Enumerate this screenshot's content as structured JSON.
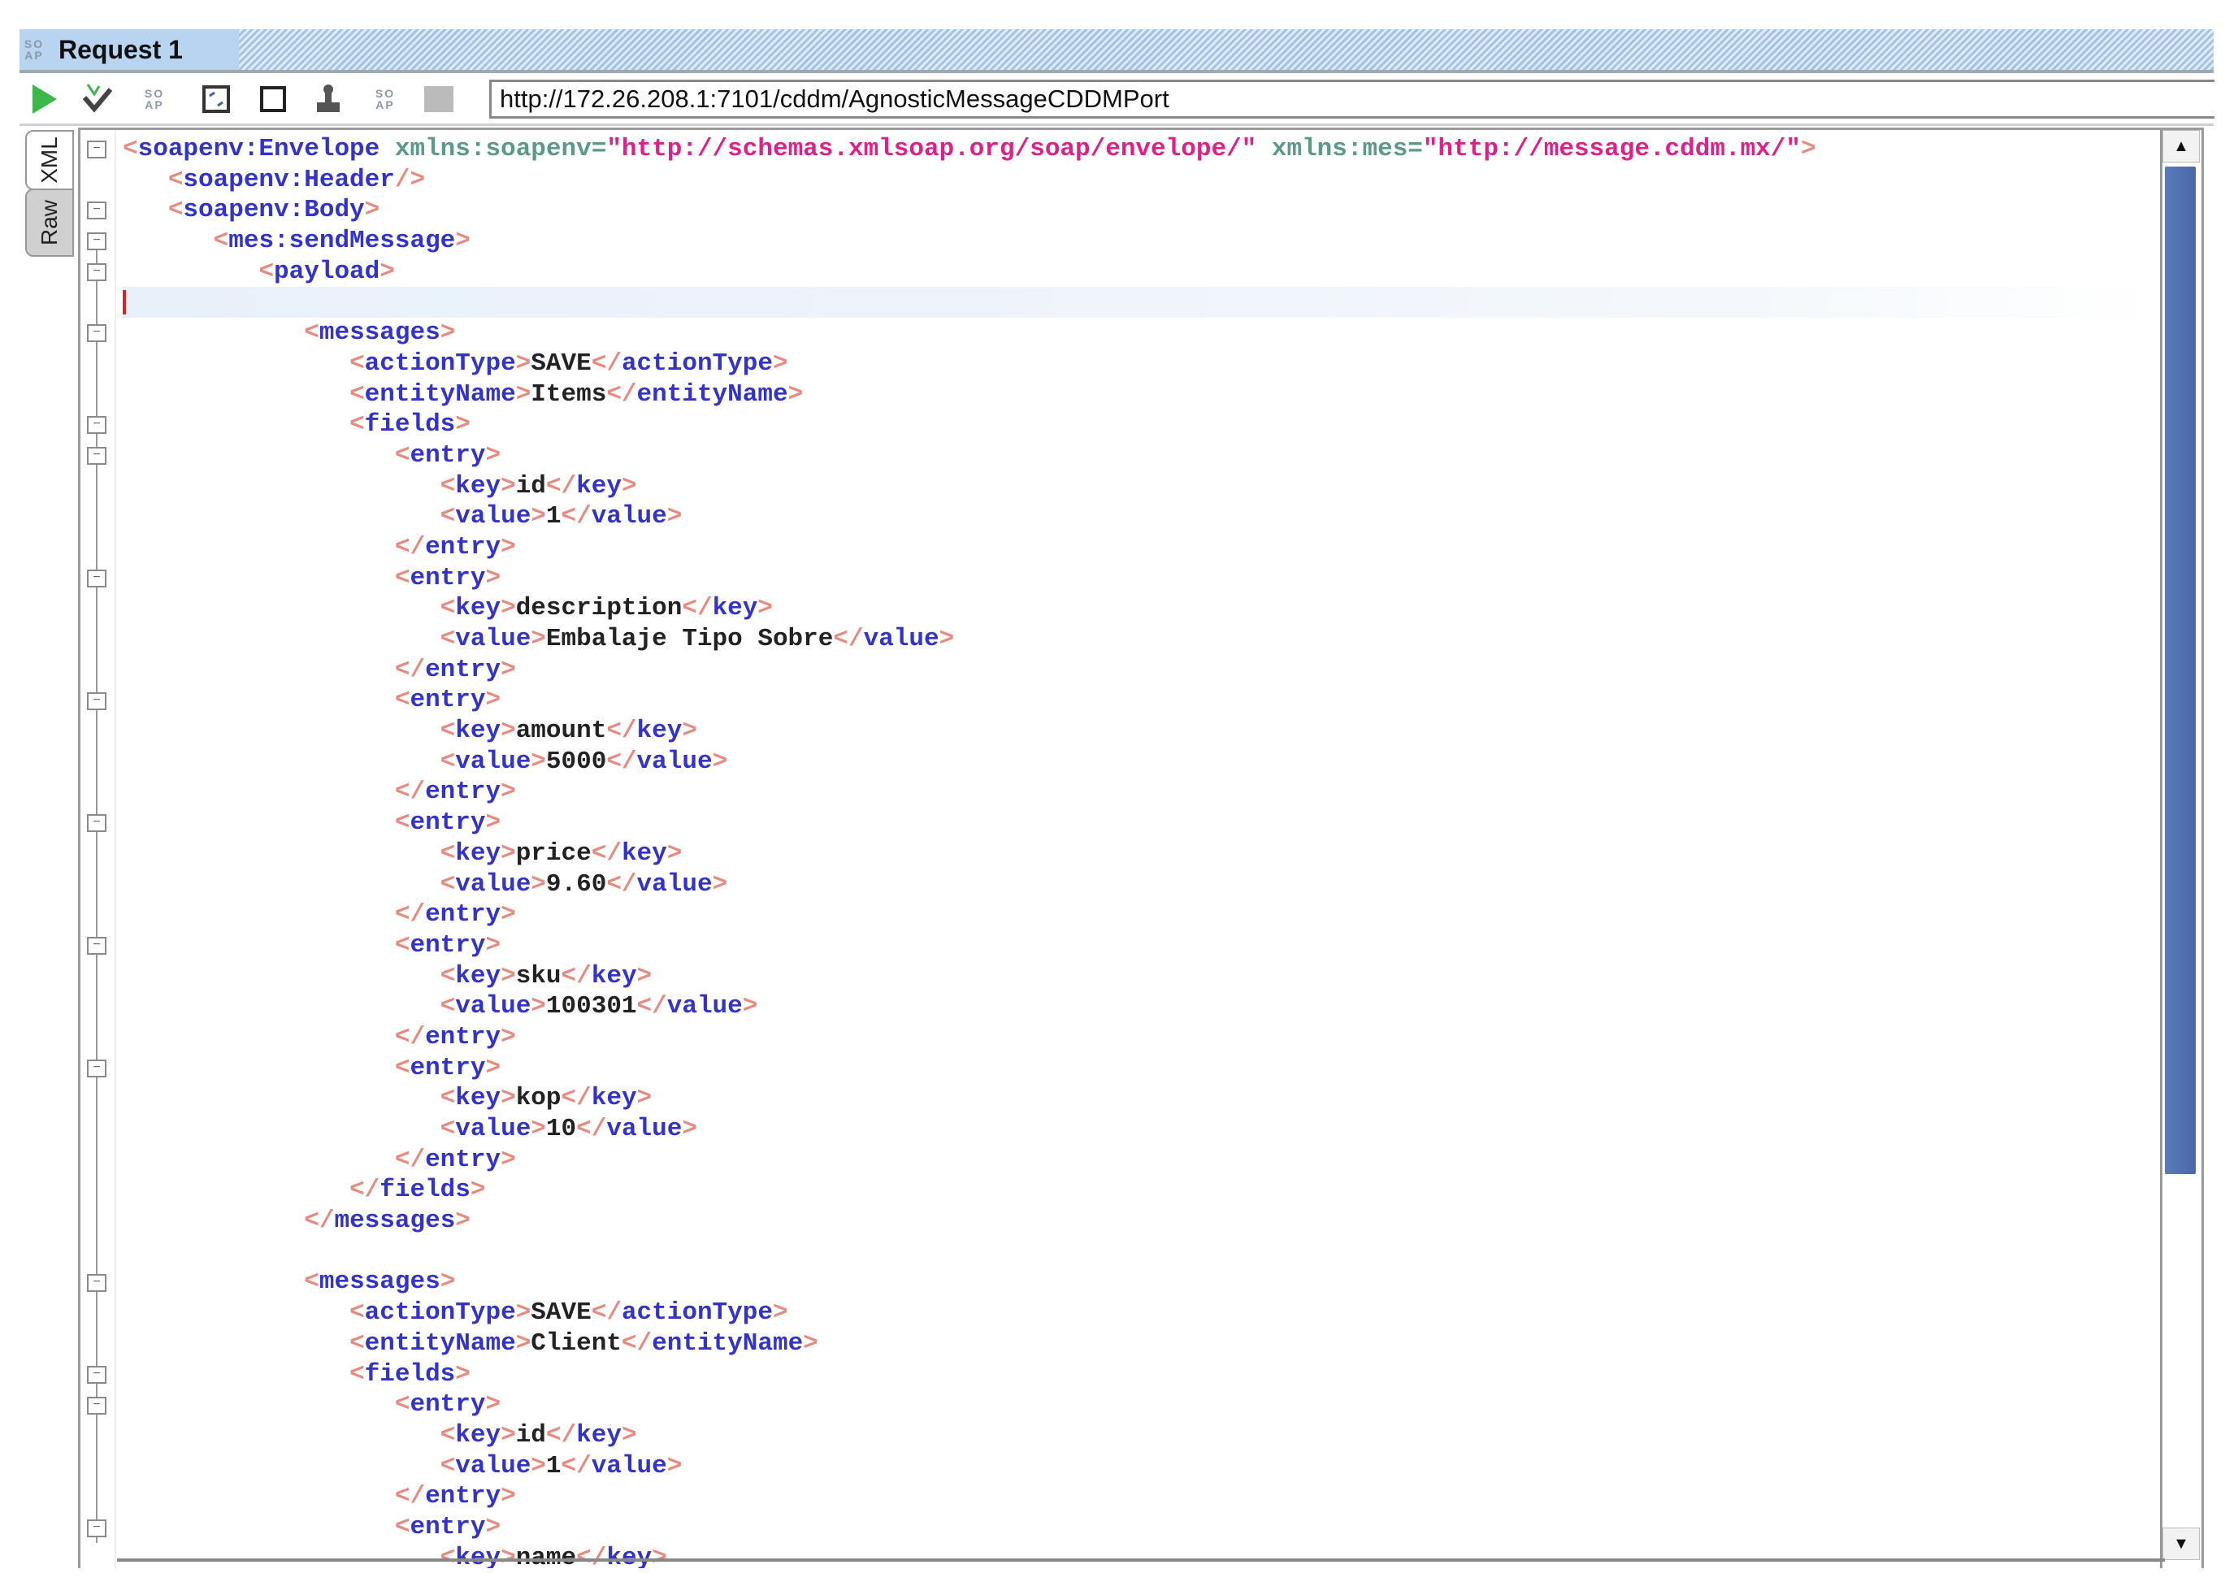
{
  "window": {
    "title": "Request 1",
    "soap_badge": "SOAP"
  },
  "toolbar": {
    "url": "http://172.26.208.1:7101/cddm/AgnosticMessageCDDMPort",
    "icons": [
      "run-icon",
      "validate-icon",
      "soap-icon",
      "frame-icon",
      "square-icon",
      "stamp-icon",
      "soap-icon",
      "stop-icon"
    ]
  },
  "side_tabs": {
    "xml": "XML",
    "raw": "Raw",
    "active": "XML"
  },
  "colors": {
    "bracket": "#e88a80",
    "tag": "#3333cc",
    "text": "#222222",
    "attr_name": "#5a9a8a",
    "attr_value": "#e0208a",
    "cursor": "#e02020",
    "scroll_thumb": "#5a7ab8"
  },
  "editor": {
    "current_line": 5,
    "scroll_position": 0.0,
    "lines": [
      {
        "indent": 0,
        "fold": true,
        "text": "<soapenv:Envelope xmlns:soapenv=\"http://schemas.xmlsoap.org/soap/envelope/\" xmlns:mes=\"http://message.cddm.mx/\">"
      },
      {
        "indent": 1,
        "text": "<soapenv:Header/>"
      },
      {
        "indent": 1,
        "fold": true,
        "text": "<soapenv:Body>"
      },
      {
        "indent": 2,
        "fold": true,
        "text": "<mes:sendMessage>"
      },
      {
        "indent": 3,
        "fold": true,
        "text": "<payload>"
      },
      {
        "indent": 0,
        "text": ""
      },
      {
        "indent": 4,
        "fold": true,
        "text": "<messages>"
      },
      {
        "indent": 5,
        "text": "<actionType>SAVE</actionType>"
      },
      {
        "indent": 5,
        "text": "<entityName>Items</entityName>"
      },
      {
        "indent": 5,
        "fold": true,
        "text": "<fields>"
      },
      {
        "indent": 6,
        "fold": true,
        "text": "<entry>"
      },
      {
        "indent": 7,
        "text": "<key>id</key>"
      },
      {
        "indent": 7,
        "text": "<value>1</value>"
      },
      {
        "indent": 6,
        "text": "</entry>"
      },
      {
        "indent": 6,
        "fold": true,
        "text": "<entry>"
      },
      {
        "indent": 7,
        "text": "<key>description</key>"
      },
      {
        "indent": 7,
        "text": "<value>Embalaje Tipo Sobre</value>"
      },
      {
        "indent": 6,
        "text": "</entry>"
      },
      {
        "indent": 6,
        "fold": true,
        "text": "<entry>"
      },
      {
        "indent": 7,
        "text": "<key>amount</key>"
      },
      {
        "indent": 7,
        "text": "<value>5000</value>"
      },
      {
        "indent": 6,
        "text": "</entry>"
      },
      {
        "indent": 6,
        "fold": true,
        "text": "<entry>"
      },
      {
        "indent": 7,
        "text": "<key>price</key>"
      },
      {
        "indent": 7,
        "text": "<value>9.60</value>"
      },
      {
        "indent": 6,
        "text": "</entry>"
      },
      {
        "indent": 6,
        "fold": true,
        "text": "<entry>"
      },
      {
        "indent": 7,
        "text": "<key>sku</key>"
      },
      {
        "indent": 7,
        "text": "<value>100301</value>"
      },
      {
        "indent": 6,
        "text": "</entry>"
      },
      {
        "indent": 6,
        "fold": true,
        "text": "<entry>"
      },
      {
        "indent": 7,
        "text": "<key>kop</key>"
      },
      {
        "indent": 7,
        "text": "<value>10</value>"
      },
      {
        "indent": 6,
        "text": "</entry>"
      },
      {
        "indent": 5,
        "text": "</fields>"
      },
      {
        "indent": 4,
        "text": "</messages>"
      },
      {
        "indent": 0,
        "text": ""
      },
      {
        "indent": 4,
        "fold": true,
        "text": "<messages>"
      },
      {
        "indent": 5,
        "text": "<actionType>SAVE</actionType>"
      },
      {
        "indent": 5,
        "text": "<entityName>Client</entityName>"
      },
      {
        "indent": 5,
        "fold": true,
        "text": "<fields>"
      },
      {
        "indent": 6,
        "fold": true,
        "text": "<entry>"
      },
      {
        "indent": 7,
        "text": "<key>id</key>"
      },
      {
        "indent": 7,
        "text": "<value>1</value>"
      },
      {
        "indent": 6,
        "text": "</entry>"
      },
      {
        "indent": 6,
        "fold": true,
        "text": "<entry>"
      },
      {
        "indent": 7,
        "text": "<key>name</key>"
      }
    ]
  }
}
